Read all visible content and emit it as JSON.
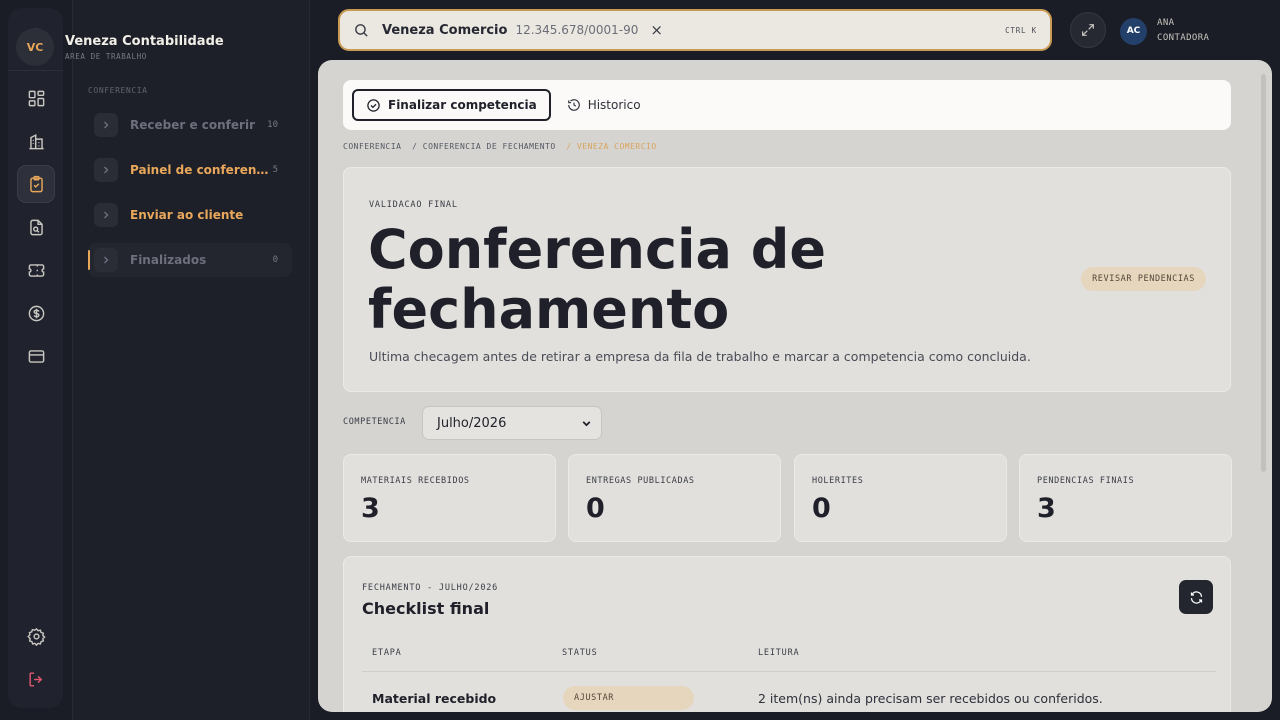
{
  "sidebar": {
    "workspace": {
      "initials": "VC",
      "name": "Veneza Contabilidade",
      "subtitle": "AREA DE TRABALHO"
    },
    "section_label": "CONFERENCIA",
    "items": [
      {
        "label": "Receber e conferir",
        "count": "10"
      },
      {
        "label": "Painel de conferencia",
        "count": "5"
      },
      {
        "label": "Enviar ao cliente",
        "count": ""
      },
      {
        "label": "Finalizados",
        "count": "0"
      }
    ]
  },
  "rail": {
    "icons": [
      "dashboard-icon",
      "building-icon",
      "clipboard-check-icon",
      "file-scan-icon",
      "ticket-icon",
      "dollar-icon",
      "credit-card-icon",
      "settings-icon",
      "logout-icon"
    ],
    "active": "clipboard-check-icon",
    "colors": {
      "active_icon": "#e8a75a",
      "logout_icon": "#e0566f"
    }
  },
  "search": {
    "query": "Veneza Comercio",
    "cnpj": "12.345.678/0001-90",
    "clear": "×",
    "shortcut": "CTRL K"
  },
  "user": {
    "initials": "AC",
    "name": "ANA",
    "role": "CONTADORA"
  },
  "toolbar": {
    "finalize_label": "Finalizar competencia",
    "history_label": "Historico"
  },
  "breadcrumb": {
    "part1": "CONFERENCIA",
    "part2": "/ CONFERENCIA DE FECHAMENTO",
    "current": "/ VENEZA COMERCIO"
  },
  "hero": {
    "eyebrow": "VALIDACAO FINAL",
    "title_line1": "Conferencia de",
    "title_line2": "fechamento",
    "description": "Ultima checagem antes de retirar a empresa da fila de trabalho e marcar a competencia como concluida.",
    "badge": "REVISAR PENDENCIAS"
  },
  "competencia": {
    "label": "COMPETENCIA",
    "selected": "Julho/2026"
  },
  "stats": [
    {
      "label": "MATERIAIS RECEBIDOS",
      "value": "3"
    },
    {
      "label": "ENTREGAS PUBLICADAS",
      "value": "0"
    },
    {
      "label": "HOLERITES",
      "value": "0"
    },
    {
      "label": "PENDENCIAS FINAIS",
      "value": "3"
    }
  ],
  "checklist": {
    "eyebrow": "FECHAMENTO - JULHO/2026",
    "title": "Checklist final",
    "columns": [
      "ETAPA",
      "STATUS",
      "LEITURA"
    ],
    "rows": [
      {
        "etapa": "Material recebido",
        "status": "AJUSTAR",
        "leitura": "2 item(ns) ainda precisam ser recebidos ou conferidos."
      }
    ]
  },
  "colors": {
    "accent": "#e8a75a",
    "search_border": "#c99a54",
    "badge_bg": "#e6d6bd"
  }
}
